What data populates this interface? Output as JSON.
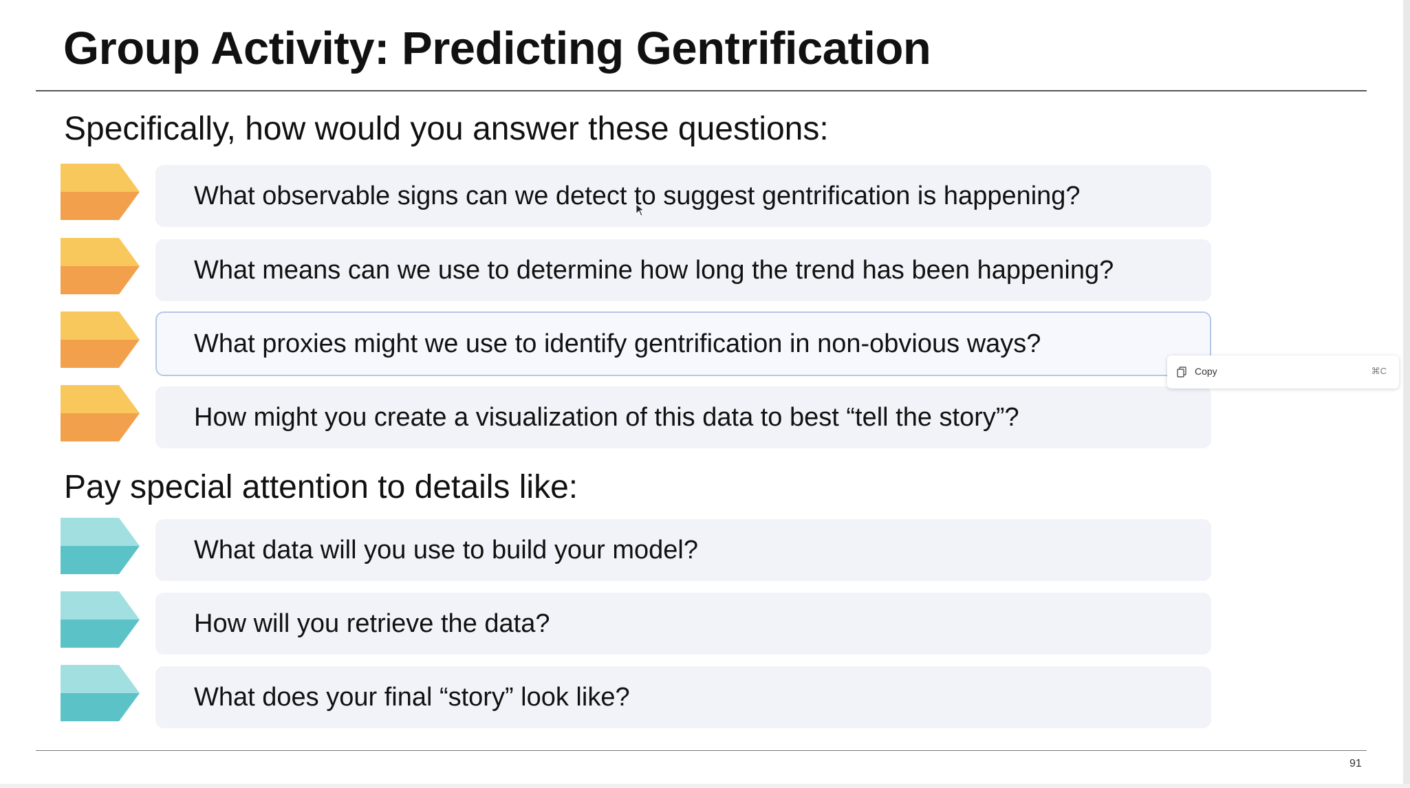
{
  "slide": {
    "title": "Group Activity: Predicting Gentrification",
    "section1_heading": "Specifically, how would you answer these questions:",
    "section1_items": [
      "What observable signs can we detect to suggest gentrification is happening?",
      "What means can we use to determine how long the trend has been happening?",
      "What proxies might we use to identify gentrification in non-obvious ways?",
      "How might you create a visualization of this data to best “tell the story”?"
    ],
    "section2_heading": "Pay special attention to details like:",
    "section2_items": [
      "What data will you use to build your model?",
      "How will you retrieve the data?",
      "What does your final “story” look like?"
    ],
    "page_number": "91"
  },
  "context_menu": {
    "copy_label": "Copy",
    "copy_shortcut": "⌘C",
    "icon": "copy-icon"
  },
  "colors": {
    "orange_light": "#F9C85C",
    "orange_dark": "#F2A04C",
    "teal_light": "#A2DFE0",
    "teal_dark": "#5BC2C7",
    "box_bg": "#F1F3F8"
  }
}
